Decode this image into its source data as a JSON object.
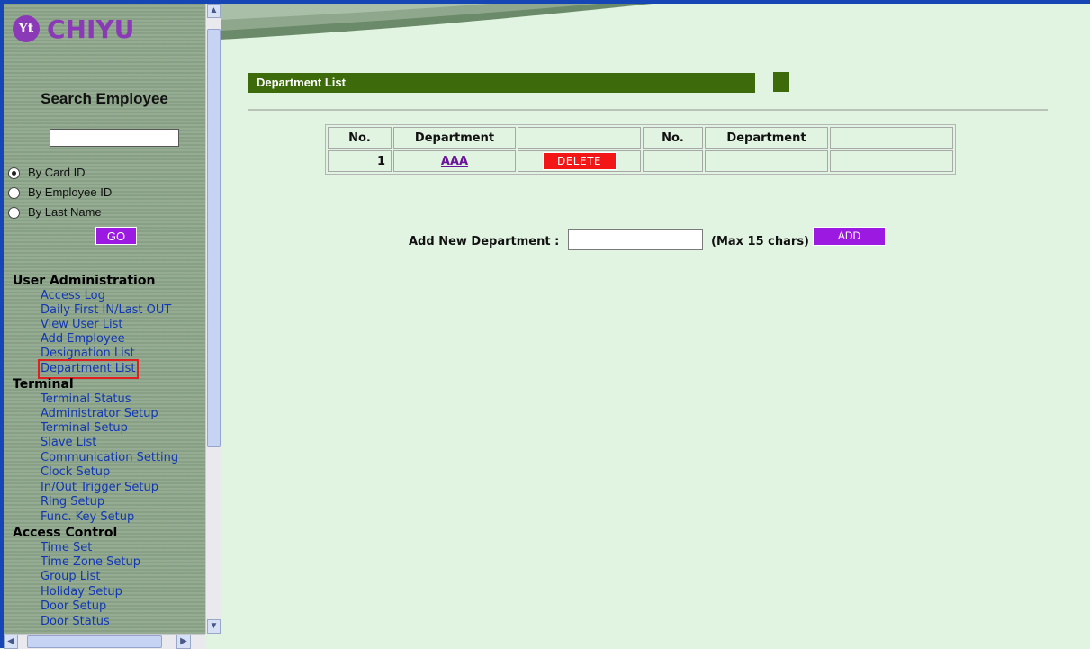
{
  "brand": {
    "logo_mark": "Yt",
    "name": "CHIYU"
  },
  "search": {
    "title": "Search Employee",
    "input_value": "",
    "options": [
      "By Card ID",
      "By Employee ID",
      "By Last Name"
    ],
    "selected_index": 0,
    "go_label": "GO"
  },
  "menu": {
    "user_admin": {
      "title": "User Administration",
      "items": [
        "Access Log",
        "Daily First IN/Last OUT",
        "View User List",
        "Add Employee",
        "Designation List",
        "Department List"
      ]
    },
    "terminal": {
      "title": "Terminal",
      "items": [
        "Terminal Status",
        "Administrator Setup",
        "Terminal Setup",
        "Slave List",
        "Communication Setting",
        "Clock Setup",
        "In/Out Trigger Setup",
        "Ring Setup",
        "Func. Key Setup"
      ]
    },
    "access_control": {
      "title": "Access Control",
      "items": [
        "Time Set",
        "Time Zone Setup",
        "Group List",
        "Holiday Setup",
        "Door Setup",
        "Door Status"
      ]
    },
    "selected_item": "Department List"
  },
  "page": {
    "title": "Department List"
  },
  "table": {
    "headers": [
      "No.",
      "Department",
      "",
      "No.",
      "Department",
      ""
    ],
    "rows": [
      {
        "no": "1",
        "department": "AAA",
        "action": "DELETE"
      }
    ]
  },
  "add_form": {
    "label": "Add New Department :",
    "input_value": "",
    "hint": "(Max 15 chars)",
    "button_label": "ADD"
  },
  "colors": {
    "sidebar_bg": "#8fa88d",
    "content_bg": "#e1f4e1",
    "title_bar": "#3d6b0c",
    "purple_button": "#9b19e0",
    "delete_button": "#f21616",
    "link": "#1237b3",
    "frame": "#1646b5"
  }
}
